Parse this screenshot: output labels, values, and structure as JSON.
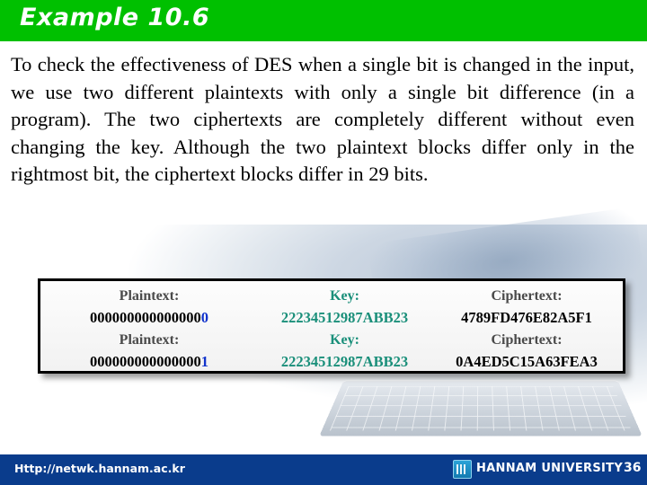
{
  "slide": {
    "title": "Example 10.6",
    "title_bar_color": "#00c000",
    "body_paragraph": "To check the effectiveness of DES when a single bit is changed in the input, we use two different plaintexts with only a single bit difference (in a program). The two ciphertexts are completely different without even changing the key. Although the two plaintext blocks differ only in the rightmost bit, the ciphertext blocks differ in 29 bits."
  },
  "figure": {
    "columns": {
      "plaintext_label": "Plaintext:",
      "key_label": "Key:",
      "ciphertext_label": "Ciphertext:"
    },
    "rows": [
      {
        "plaintext_label": "Plaintext:",
        "plaintext_value_prefix": "000000000000000",
        "plaintext_value_lastbit": "0",
        "key_label": "Key:",
        "key_value": "22234512987ABB23",
        "ciphertext_label": "Ciphertext:",
        "ciphertext_value": "4789FD476E82A5F1"
      },
      {
        "plaintext_label": "Plaintext:",
        "plaintext_value_prefix": "000000000000000",
        "plaintext_value_lastbit": "1",
        "key_label": "Key:",
        "key_value": "22234512987ABB23",
        "ciphertext_label": "Ciphertext:",
        "ciphertext_value": "0A4ED5C15A63FEA3"
      }
    ],
    "key_color": "#1a8f7a",
    "highlight_bit_color": "#1133cc"
  },
  "footer": {
    "url": "Http://netwk.hannam.ac.kr",
    "university": "HANNAM  UNIVERSITY",
    "logo_icon": "university-emblem-icon",
    "page_number": "36",
    "bar_color": "#0a3c8c"
  }
}
